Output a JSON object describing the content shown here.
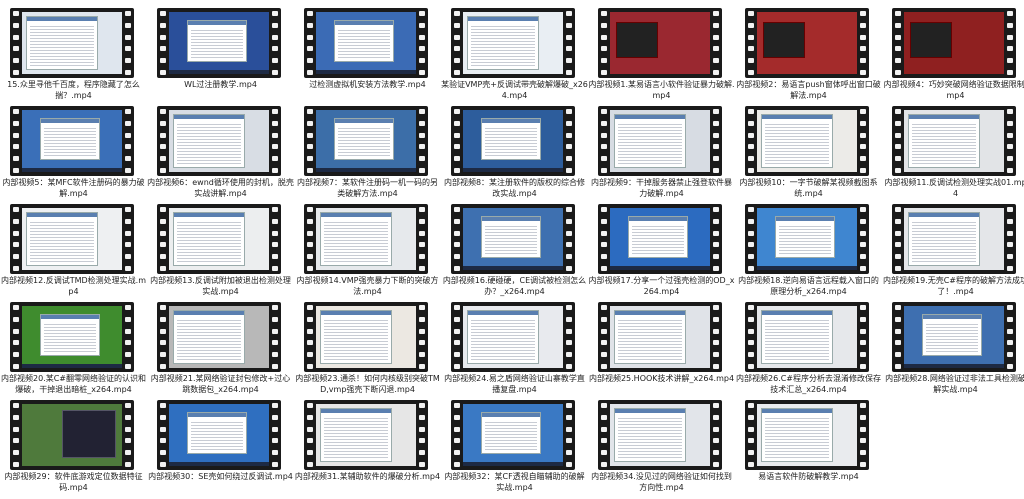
{
  "files": [
    {
      "name": "15.众里寻他千百度，程序隐藏了怎么揣？.mp4",
      "bg": "#dfe6ee",
      "style": "window"
    },
    {
      "name": "WL过注册教学.mp4",
      "bg": "#2a4f9a",
      "style": "win11"
    },
    {
      "name": "过检测虚拟机安装方法教学.mp4",
      "bg": "#3b6bb5",
      "style": "desktop"
    },
    {
      "name": "某验证VMP壳+反调试带壳破解爆破_x264.mp4",
      "bg": "#e9eef3",
      "style": "window"
    },
    {
      "name": "内部视频1.某易语言小软件验证暴力破解.mp4",
      "bg": "#9a2830",
      "style": "dark"
    },
    {
      "name": "内部视频2：易语言push窗体呼出窗口破解法.mp4",
      "bg": "#a42b2b",
      "style": "dark"
    },
    {
      "name": "内部视频4：巧妙突破网络验证数据限制.mp4",
      "bg": "#8f2020",
      "style": "dark"
    },
    {
      "name": "内部视频5：某MFC软件注册码的暴力破解.mp4",
      "bg": "#3a6fb8",
      "style": "desktop"
    },
    {
      "name": "内部视频6：ewnd循环使用的封机，脱壳实战讲解.mp4",
      "bg": "#d8dde4",
      "style": "window"
    },
    {
      "name": "内部视频7：某软件注册码一机一码的另类破解方法.mp4",
      "bg": "#3c6ea8",
      "style": "desktop"
    },
    {
      "name": "内部视频8：某注册软件的版权的综合修改实战.mp4",
      "bg": "#2d5d9c",
      "style": "desktop"
    },
    {
      "name": "内部视频9：干掉服务器禁止强登软件暴力破解.mp4",
      "bg": "#d7dce3",
      "style": "window"
    },
    {
      "name": "内部视频10：一字节破解某视频截图系统.mp4",
      "bg": "#ecebe8",
      "style": "window"
    },
    {
      "name": "内部视频11.反调试检测处理实战01.mp4",
      "bg": "#e2e4e7",
      "style": "window"
    },
    {
      "name": "内部视频12.反调试TMD检测处理实战.mp4",
      "bg": "#eef0f2",
      "style": "window"
    },
    {
      "name": "内部视频13.反调试附加被退出检测处理实战.mp4",
      "bg": "#eceeef",
      "style": "window"
    },
    {
      "name": "内部视频14.VMP强壳暴力下断的突破方法.mp4",
      "bg": "#e6e9ec",
      "style": "window"
    },
    {
      "name": "内部视频16.硬碰硬，CE调试被检测怎么办？_x264.mp4",
      "bg": "#3e70b0",
      "style": "desktop"
    },
    {
      "name": "内部视频17.分享一个过强壳检测的OD_x264.mp4",
      "bg": "#2c6bc0",
      "style": "desktop"
    },
    {
      "name": "内部视频18.逆向易语言远程载入窗口的原理分析_x264.mp4",
      "bg": "#3f86d0",
      "style": "desktop"
    },
    {
      "name": "内部视频19.无壳C#程序的破解方法成功了！.mp4",
      "bg": "#e4e6e9",
      "style": "window"
    },
    {
      "name": "内部视频20.某C#翻零网络验证的认识和爆破，干掉退出暗桩_x264.mp4",
      "bg": "#3f8c2e",
      "style": "green"
    },
    {
      "name": "内部视频21.某网络验证封包修改+过心跳数据包_x264.mp4",
      "bg": "#b8b8b8",
      "style": "gray"
    },
    {
      "name": "内部视频23.通杀！如何内核级别突破TMD,vmp强壳下断闪退.mp4",
      "bg": "#ece8e2",
      "style": "window"
    },
    {
      "name": "内部视频24.易之盾网络验证山寨教学直播复盘.mp4",
      "bg": "#e8eaee",
      "style": "window"
    },
    {
      "name": "内部视频25.HOOK技术讲解_x264.mp4",
      "bg": "#e0e3e8",
      "style": "window"
    },
    {
      "name": "内部视频26.C#程序分析去混淆修改保存技术汇总_x264.mp4",
      "bg": "#e6e8eb",
      "style": "window"
    },
    {
      "name": "内部视频28.网络验证过非法工具检测破解实战.mp4",
      "bg": "#3e6fb0",
      "style": "desktop"
    },
    {
      "name": "内部视频29：软件底游戏定位数据特征码.mp4",
      "bg": "#4f7a3c",
      "style": "game"
    },
    {
      "name": "内部视频30：SE壳如何绕过反调试.mp4",
      "bg": "#2f6fc0",
      "style": "desktop"
    },
    {
      "name": "内部视频31.某辅助软件的爆破分析.mp4",
      "bg": "#e6e6e6",
      "style": "window"
    },
    {
      "name": "内部视频32：某CF透视自瞄辅助的破解实战.mp4",
      "bg": "#3a79c4",
      "style": "desktop"
    },
    {
      "name": "内部视频34.没见过的网络验证如何找到方向性.mp4",
      "bg": "#e2e5ea",
      "style": "window"
    },
    {
      "name": "易语言软件防破解教学.mp4",
      "bg": "#e9ebee",
      "style": "window"
    }
  ]
}
